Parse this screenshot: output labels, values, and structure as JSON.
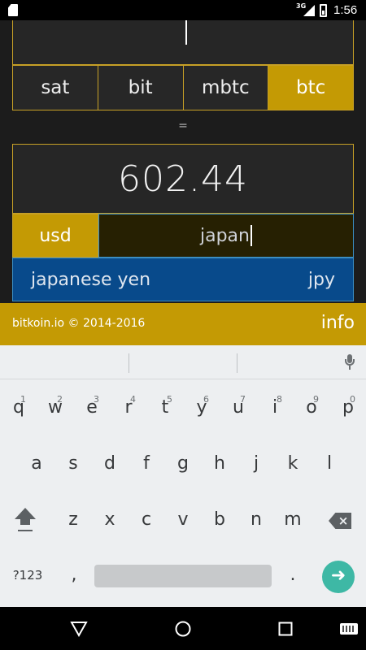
{
  "status_bar": {
    "network": "3G",
    "time": "1:56"
  },
  "converter": {
    "units": [
      {
        "label": "sat",
        "active": false
      },
      {
        "label": "bit",
        "active": false
      },
      {
        "label": "mbtc",
        "active": false
      },
      {
        "label": "btc",
        "active": true
      }
    ],
    "equals": "=",
    "result": "602.44",
    "currency_code": "usd",
    "currency_search_value": "japan",
    "suggestion": {
      "name": "japanese yen",
      "code": "jpy"
    }
  },
  "footer": {
    "copyright": "bitkoin.io © 2014-2016",
    "info_label": "info"
  },
  "keyboard": {
    "row1": [
      {
        "k": "q",
        "n": "1"
      },
      {
        "k": "w",
        "n": "2"
      },
      {
        "k": "e",
        "n": "3"
      },
      {
        "k": "r",
        "n": "4"
      },
      {
        "k": "t",
        "n": "5"
      },
      {
        "k": "y",
        "n": "6"
      },
      {
        "k": "u",
        "n": "7"
      },
      {
        "k": "i",
        "n": "8"
      },
      {
        "k": "o",
        "n": "9"
      },
      {
        "k": "p",
        "n": "0"
      }
    ],
    "row2": [
      "a",
      "s",
      "d",
      "f",
      "g",
      "h",
      "j",
      "k",
      "l"
    ],
    "row3": [
      "z",
      "x",
      "c",
      "v",
      "b",
      "n",
      "m"
    ],
    "symbols_label": "?123",
    "comma": ",",
    "period": "."
  },
  "icons": {
    "mic": "microphone-icon",
    "shift": "shift-icon",
    "backspace": "backspace-icon",
    "go": "arrow-right-icon",
    "back": "back-triangle-icon",
    "home": "home-circle-icon",
    "recents": "recents-square-icon",
    "keyboard_switch": "keyboard-icon"
  },
  "colors": {
    "gold": "#c49a04",
    "blue": "#084a8b",
    "go": "#3eb8a5"
  }
}
